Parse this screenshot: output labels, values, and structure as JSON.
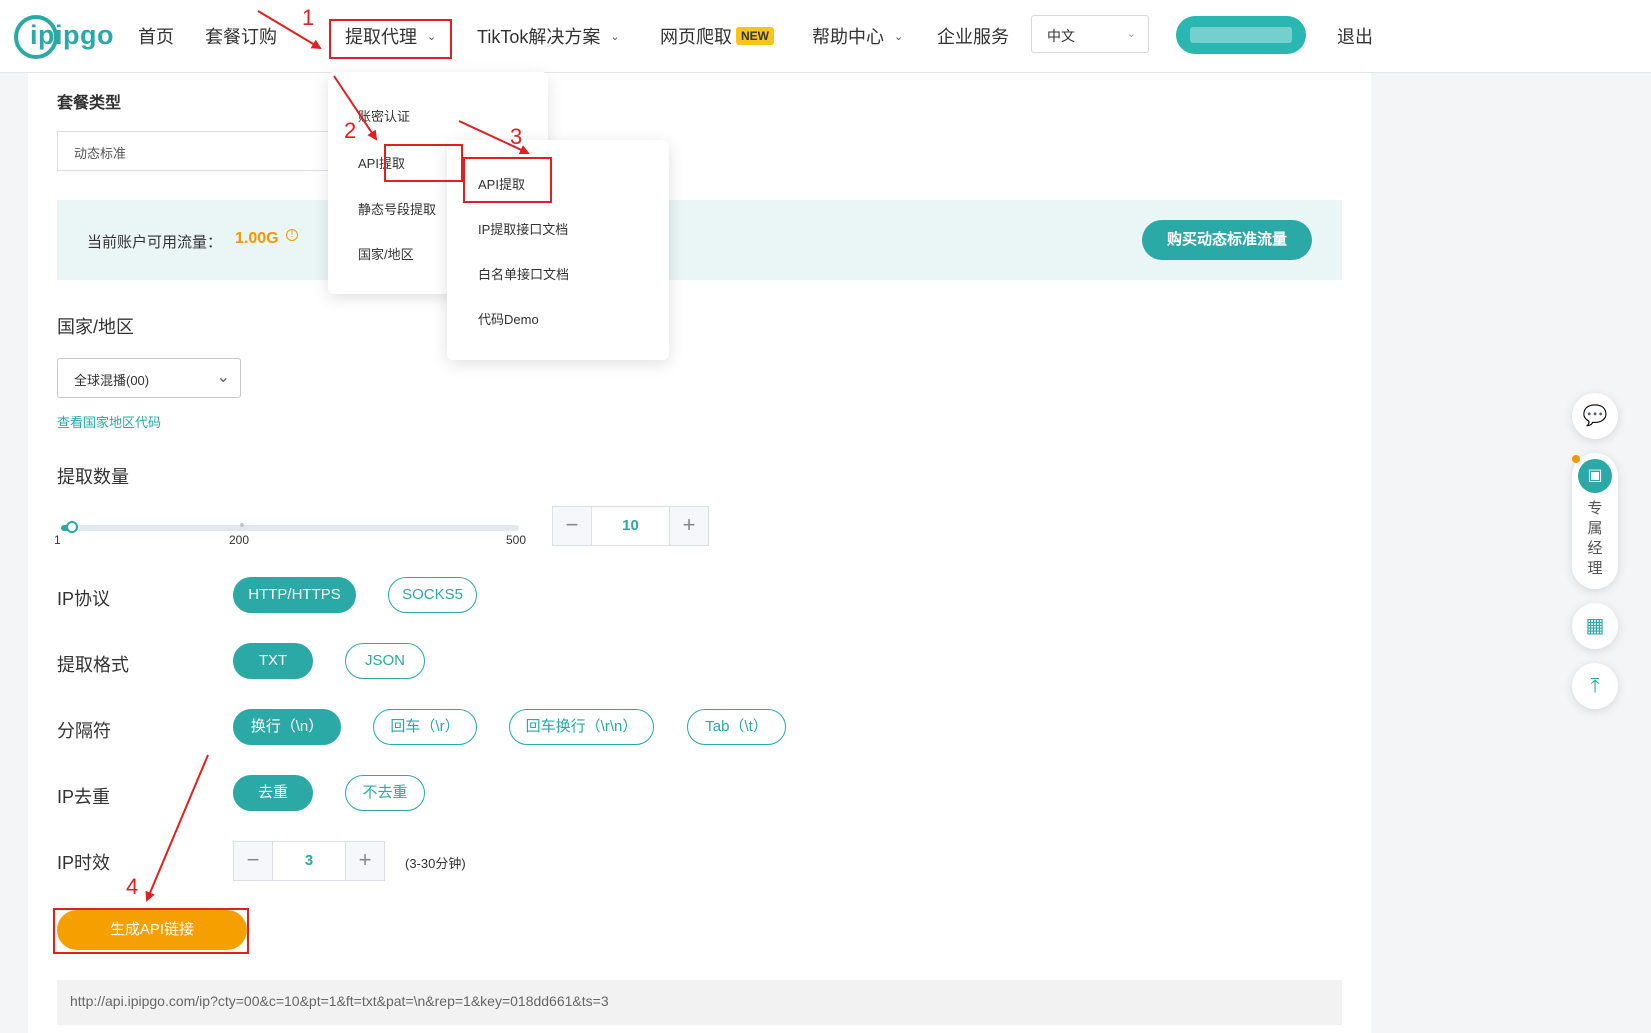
{
  "header": {
    "logo_text": "ipipgo",
    "nav": {
      "home": "首页",
      "plans": "套餐订购",
      "extract_proxy": "提取代理",
      "tiktok": "TikTok解决方案",
      "scraper": "网页爬取",
      "scraper_badge": "NEW",
      "help": "帮助中心",
      "enterprise": "企业服务"
    },
    "language": "中文",
    "logout": "退出"
  },
  "menu_primary": {
    "items": [
      "账密认证",
      "API提取",
      "静态号段提取",
      "国家/地区"
    ]
  },
  "menu_secondary": {
    "items": [
      "API提取",
      "IP提取接口文档",
      "白名单接口文档",
      "代码Demo"
    ]
  },
  "form": {
    "package_type_label": "套餐类型",
    "package_type_value": "动态标准",
    "traffic_label": "当前账户可用流量：",
    "traffic_value": "1.00G",
    "buy_button": "购买动态标准流量",
    "region_label": "国家/地区",
    "region_value": "全球混播(00)",
    "region_link": "查看国家地区代码",
    "quantity_label": "提取数量",
    "slider": {
      "min_label": "1",
      "mid_label": "200",
      "max_label": "500",
      "value": 10
    },
    "quantity_value": "10",
    "protocol_label": "IP协议",
    "protocol_options": [
      "HTTP/HTTPS",
      "SOCKS5"
    ],
    "format_label": "提取格式",
    "format_options": [
      "TXT",
      "JSON"
    ],
    "separator_label": "分隔符",
    "separator_options": [
      "换行（\\n）",
      "回车（\\r）",
      "回车换行（\\r\\n）",
      "Tab（\\t）"
    ],
    "dedupe_label": "IP去重",
    "dedupe_options": [
      "去重",
      "不去重"
    ],
    "duration_label": "IP时效",
    "duration_value": "3",
    "duration_hint": "(3-30分钟)",
    "generate_button": "生成API链接",
    "result_url": "http://api.ipipgo.com/ip?cty=00&c=10&pt=1&ft=txt&pat=\\n&rep=1&key=018dd661&ts=3"
  },
  "float_bar": {
    "manager_label": "专属经理"
  },
  "annotations": [
    "1",
    "2",
    "3",
    "4"
  ],
  "colors": {
    "accent": "#2aa9a7",
    "orange": "#f5a000",
    "annotation_red": "#e02020"
  }
}
